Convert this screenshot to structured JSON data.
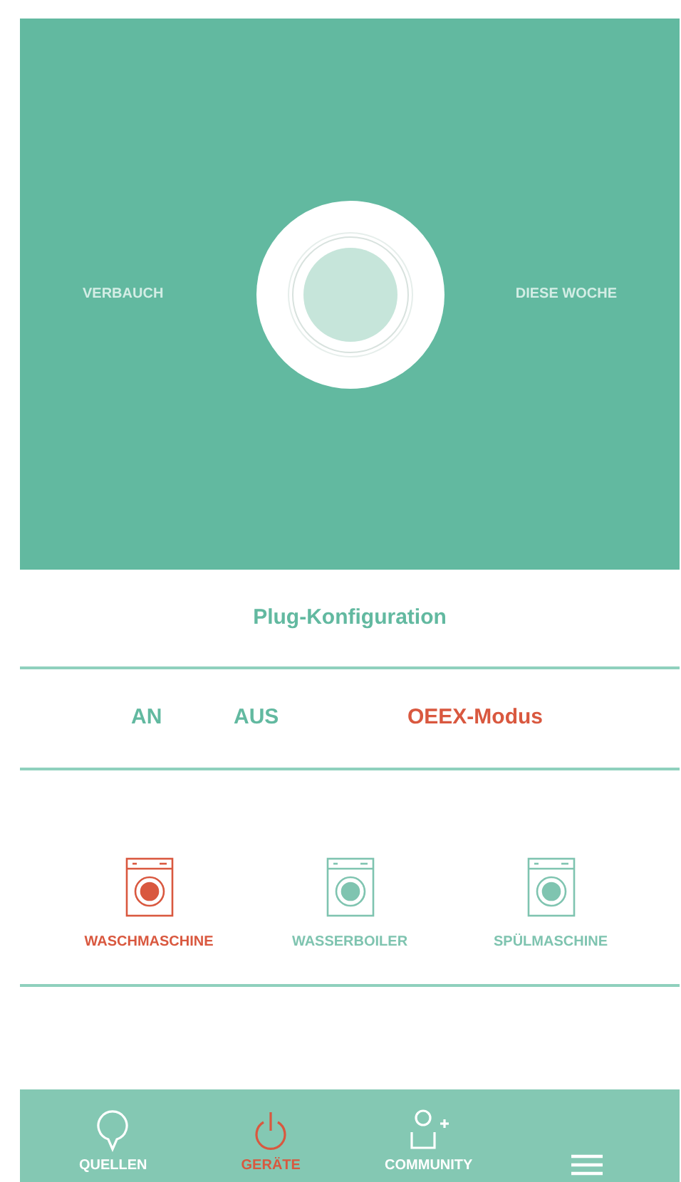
{
  "hero": {
    "left_label": "VERBAUCH",
    "right_label": "DIESE WOCHE"
  },
  "section_title": "Plug-Konfiguration",
  "modes": [
    {
      "label": "AN",
      "selected": false
    },
    {
      "label": "AUS",
      "selected": false
    },
    {
      "label": "OEEX-Modus",
      "selected": true
    }
  ],
  "devices": [
    {
      "label": "WASCHMASCHINE",
      "selected": true
    },
    {
      "label": "WASSERBOILER",
      "selected": false
    },
    {
      "label": "SPÜLMASCHINE",
      "selected": false
    }
  ],
  "nav": [
    {
      "kind": "sources",
      "label": "QUELLEN",
      "selected": false
    },
    {
      "kind": "devices",
      "label": "GERÄTE",
      "selected": true
    },
    {
      "kind": "community",
      "label": "COMMUNITY",
      "selected": false
    },
    {
      "kind": "menu",
      "selected": false
    }
  ]
}
